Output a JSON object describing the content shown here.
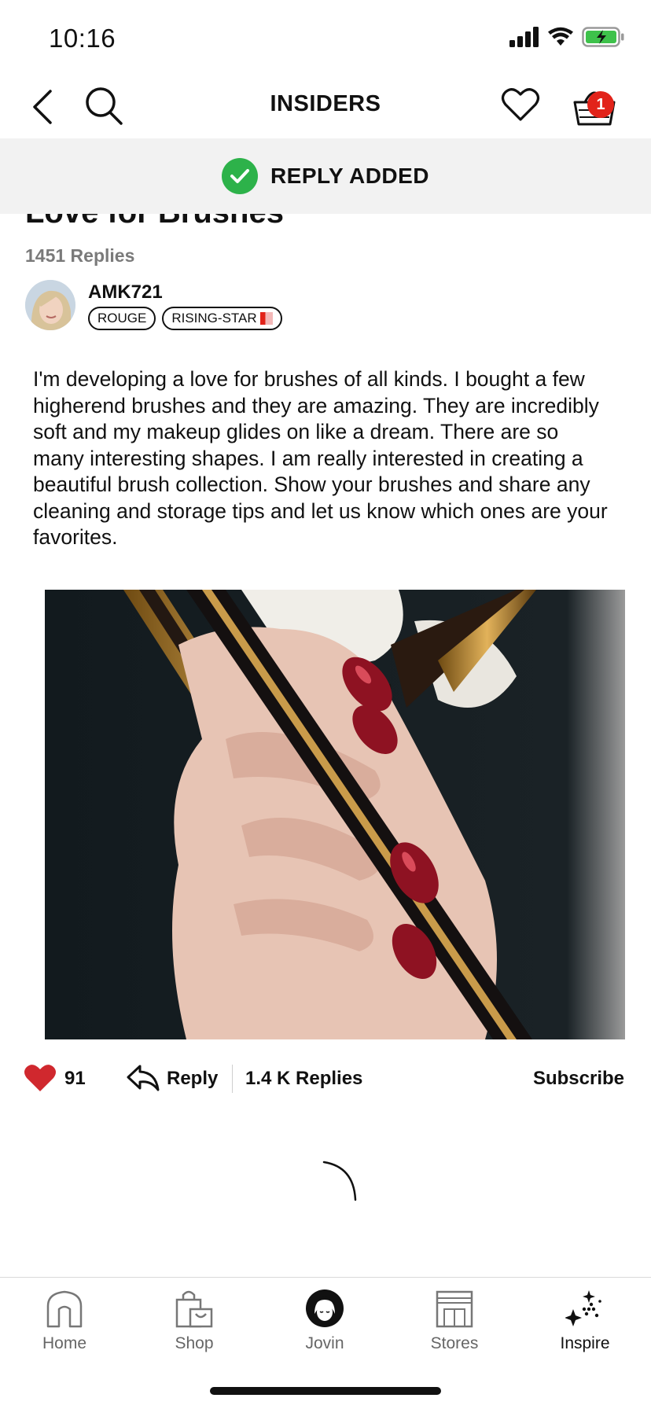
{
  "status_bar": {
    "time": "10:16"
  },
  "nav": {
    "title": "INSIDERS",
    "basket_count": "1"
  },
  "toast": {
    "message": "REPLY ADDED"
  },
  "post": {
    "title": "Love for Brushes",
    "reply_count": "1451 Replies",
    "author": {
      "username": "AMK721",
      "badges": [
        "ROUGE",
        "RISING-STAR"
      ]
    },
    "body": "I'm developing a love for brushes of all kinds. I bought a few higherend brushes and they are amazing. They are incredibly soft and my makeup glides on like a dream. There are so many interesting shapes. I am really interested in creating a beautiful brush collection. Show your brushes and share any cleaning and storage tips and let us know which ones are your favorites."
  },
  "actions": {
    "like_count": "91",
    "reply_label": "Reply",
    "replies_label": "1.4 K Replies",
    "subscribe_label": "Subscribe"
  },
  "tabs": [
    {
      "label": "Home",
      "icon": "home-icon"
    },
    {
      "label": "Shop",
      "icon": "shopping-bag-icon"
    },
    {
      "label": "Jovin",
      "icon": "profile-icon"
    },
    {
      "label": "Stores",
      "icon": "store-icon"
    },
    {
      "label": "Inspire",
      "icon": "sparkle-icon",
      "active": true
    }
  ],
  "colors": {
    "accent_red": "#e2231a",
    "success_green": "#2db24a",
    "toast_bg": "#f2f2f2"
  }
}
